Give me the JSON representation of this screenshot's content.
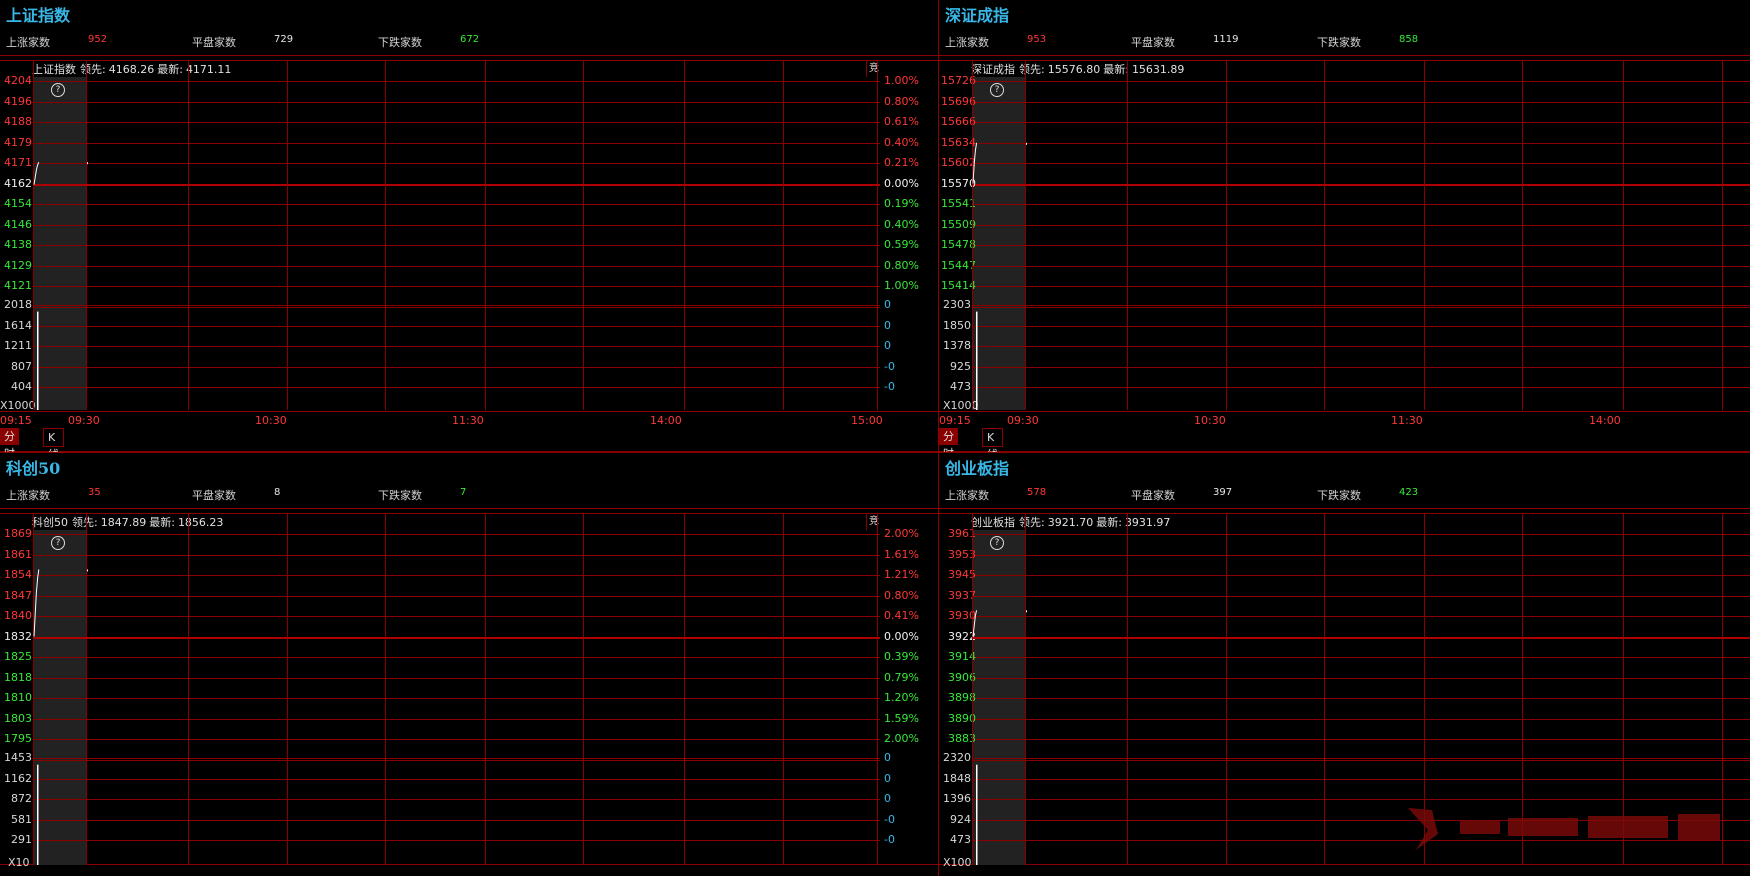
{
  "panels": [
    {
      "title": "上证指数",
      "breadth": {
        "up_label": "上涨家数",
        "up": "952",
        "flat_label": "平盘家数",
        "flat": "729",
        "down_label": "下跌家数",
        "down": "672"
      },
      "header": {
        "name": "上证指数",
        "lead_label": "领先:",
        "lead": "4168.26",
        "latest_label": "最新:",
        "latest": "4171.11"
      },
      "corner": "竞",
      "price_up": [
        "4204",
        "4196",
        "4188",
        "4179",
        "4171"
      ],
      "price_base": "4162",
      "price_down": [
        "4154",
        "4146",
        "4138",
        "4129",
        "4121"
      ],
      "pct_up": [
        "1.00%",
        "0.80%",
        "0.61%",
        "0.40%",
        "0.21%"
      ],
      "pct_base": "0.00%",
      "pct_down": [
        "0.19%",
        "0.40%",
        "0.59%",
        "0.80%",
        "1.00%"
      ],
      "vol_labels": [
        "2018",
        "1614",
        "1211",
        "807",
        "404"
      ],
      "vol_multiplier": "X1000",
      "vol_right": [
        "0",
        "0",
        "0",
        "-0",
        "-0"
      ],
      "times": [
        "09:15",
        "09:30",
        "10:30",
        "11:30",
        "14:00",
        "15:00"
      ],
      "tabs": [
        "分时图",
        "K线图"
      ],
      "price_series": [
        4162,
        4165,
        4168,
        4170,
        4171.11
      ],
      "volume_fraction": 0.92
    },
    {
      "title": "深证成指",
      "breadth": {
        "up_label": "上涨家数",
        "up": "953",
        "flat_label": "平盘家数",
        "flat": "1119",
        "down_label": "下跌家数",
        "down": "858"
      },
      "header": {
        "name": "深证成指",
        "lead_label": "领先:",
        "lead": "15576.80",
        "latest_label": "最新:",
        "latest": "15631.89"
      },
      "corner": "",
      "price_up": [
        "15726",
        "15696",
        "15666",
        "15634",
        "15602"
      ],
      "price_base": "15570",
      "price_down": [
        "15541",
        "15509",
        "15478",
        "15447",
        "15414"
      ],
      "pct_up": [],
      "pct_base": "",
      "pct_down": [],
      "vol_labels": [
        "2303",
        "1850",
        "1378",
        "925",
        "473"
      ],
      "vol_multiplier": "X1000",
      "vol_right": [],
      "times": [
        "09:15",
        "09:30",
        "10:30",
        "11:30",
        "14:00"
      ],
      "tabs": [
        "分时图",
        "K线图"
      ],
      "price_series": [
        15570,
        15600,
        15620,
        15631.89
      ],
      "volume_fraction": 0.92
    },
    {
      "title": "科创50",
      "breadth": {
        "up_label": "上涨家数",
        "up": "35",
        "flat_label": "平盘家数",
        "flat": "8",
        "down_label": "下跌家数",
        "down": "7"
      },
      "header": {
        "name": "科创50",
        "lead_label": "领先:",
        "lead": "1847.89",
        "latest_label": "最新:",
        "latest": "1856.23"
      },
      "corner": "竞",
      "price_up": [
        "1869",
        "1861",
        "1854",
        "1847",
        "1840"
      ],
      "price_base": "1832",
      "price_down": [
        "1825",
        "1818",
        "1810",
        "1803",
        "1795"
      ],
      "pct_up": [
        "2.00%",
        "1.61%",
        "1.21%",
        "0.80%",
        "0.41%"
      ],
      "pct_base": "0.00%",
      "pct_down": [
        "0.39%",
        "0.79%",
        "1.20%",
        "1.59%",
        "2.00%"
      ],
      "vol_labels": [
        "1453",
        "1162",
        "872",
        "581",
        "291"
      ],
      "vol_multiplier": "X10",
      "vol_right": [
        "0",
        "0",
        "0",
        "-0",
        "-0"
      ],
      "times": [],
      "tabs": [],
      "price_series": [
        1832,
        1840,
        1848,
        1853,
        1856.23
      ],
      "volume_fraction": 0.92
    },
    {
      "title": "创业板指",
      "breadth": {
        "up_label": "上涨家数",
        "up": "578",
        "flat_label": "平盘家数",
        "flat": "397",
        "down_label": "下跌家数",
        "down": "423"
      },
      "header": {
        "name": "创业板指",
        "lead_label": "领先:",
        "lead": "3921.70",
        "latest_label": "最新:",
        "latest": "3931.97"
      },
      "corner": "",
      "price_up": [
        "3961",
        "3953",
        "3945",
        "3937",
        "3930"
      ],
      "price_base": "3922",
      "price_down": [
        "3914",
        "3906",
        "3898",
        "3890",
        "3883"
      ],
      "pct_up": [],
      "pct_base": "",
      "pct_down": [],
      "vol_labels": [
        "2320",
        "1848",
        "1396",
        "924",
        "473"
      ],
      "vol_multiplier": "X100",
      "vol_right": [],
      "times": [],
      "tabs": [],
      "price_series": [
        3922,
        3926,
        3930,
        3931.97
      ],
      "volume_fraction": 0.92
    }
  ]
}
